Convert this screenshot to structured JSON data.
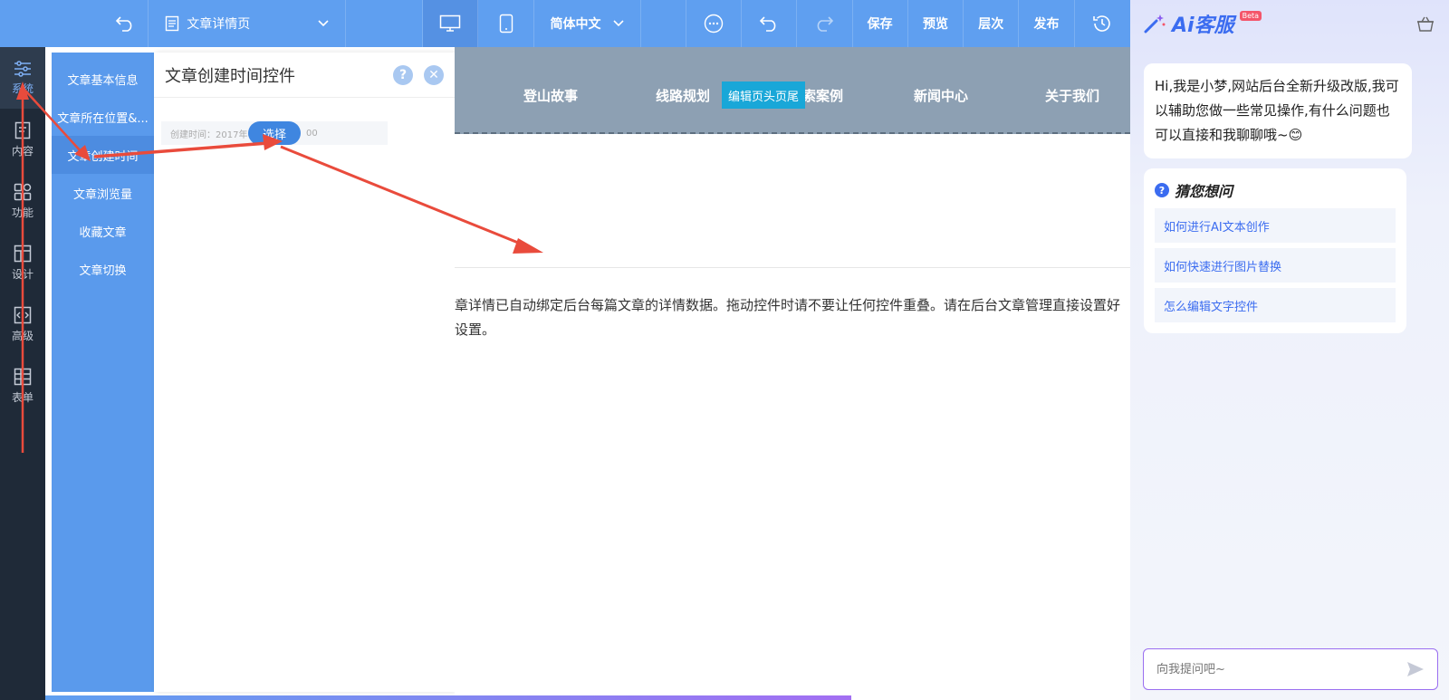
{
  "toolbar": {
    "page_name": "文章详情页",
    "language": "简体中文",
    "save": "保存",
    "preview": "预览",
    "layers": "层次",
    "publish": "发布"
  },
  "rail": {
    "items": [
      {
        "label": "系统",
        "icon": "sliders-icon"
      },
      {
        "label": "内容",
        "icon": "document-icon"
      },
      {
        "label": "功能",
        "icon": "grid-icon"
      },
      {
        "label": "设计",
        "icon": "layout-icon"
      },
      {
        "label": "高级",
        "icon": "code-icon"
      },
      {
        "label": "表单",
        "icon": "form-icon"
      }
    ]
  },
  "submenu": {
    "items": [
      "文章基本信息",
      "文章所在位置&...",
      "文章创建时间",
      "文章浏览量",
      "收藏文章",
      "文章切换"
    ]
  },
  "panel": {
    "title": "文章创建时间控件",
    "field_text": "创建时间：2017年0",
    "field_tail": "00",
    "select_button": "选择"
  },
  "canvas": {
    "nav_items": [
      "登山故事",
      "线路规划",
      "索案例",
      "新闻中心",
      "关于我们"
    ],
    "nav_badge": "编辑页头页尾",
    "notice_line1": "章详情已自动绑定后台每篇文章的详情数据。拖动控件时请不要让任何控件重叠。请在后台文章管理直接设置好",
    "notice_line2": "设置。"
  },
  "ai": {
    "title": "Ai客服",
    "beta": "Beta",
    "greeting": "Hi,我是小梦,网站后台全新升级改版,我可以辅助您做一些常见操作,有什么问题也可以直接和我聊聊哦~😊",
    "guess_title": "猜您想问",
    "questions": [
      "如何进行AI文本创作",
      "如何快速进行图片替换",
      "怎么编辑文字控件"
    ],
    "input_placeholder": "向我提问吧~"
  },
  "colors": {
    "toolbar": "#5f9ff0",
    "rail": "#1f2a38",
    "submenu": "#5a9aec",
    "accent": "#3b6cf0",
    "annotation_arrow": "#e94b3c"
  }
}
